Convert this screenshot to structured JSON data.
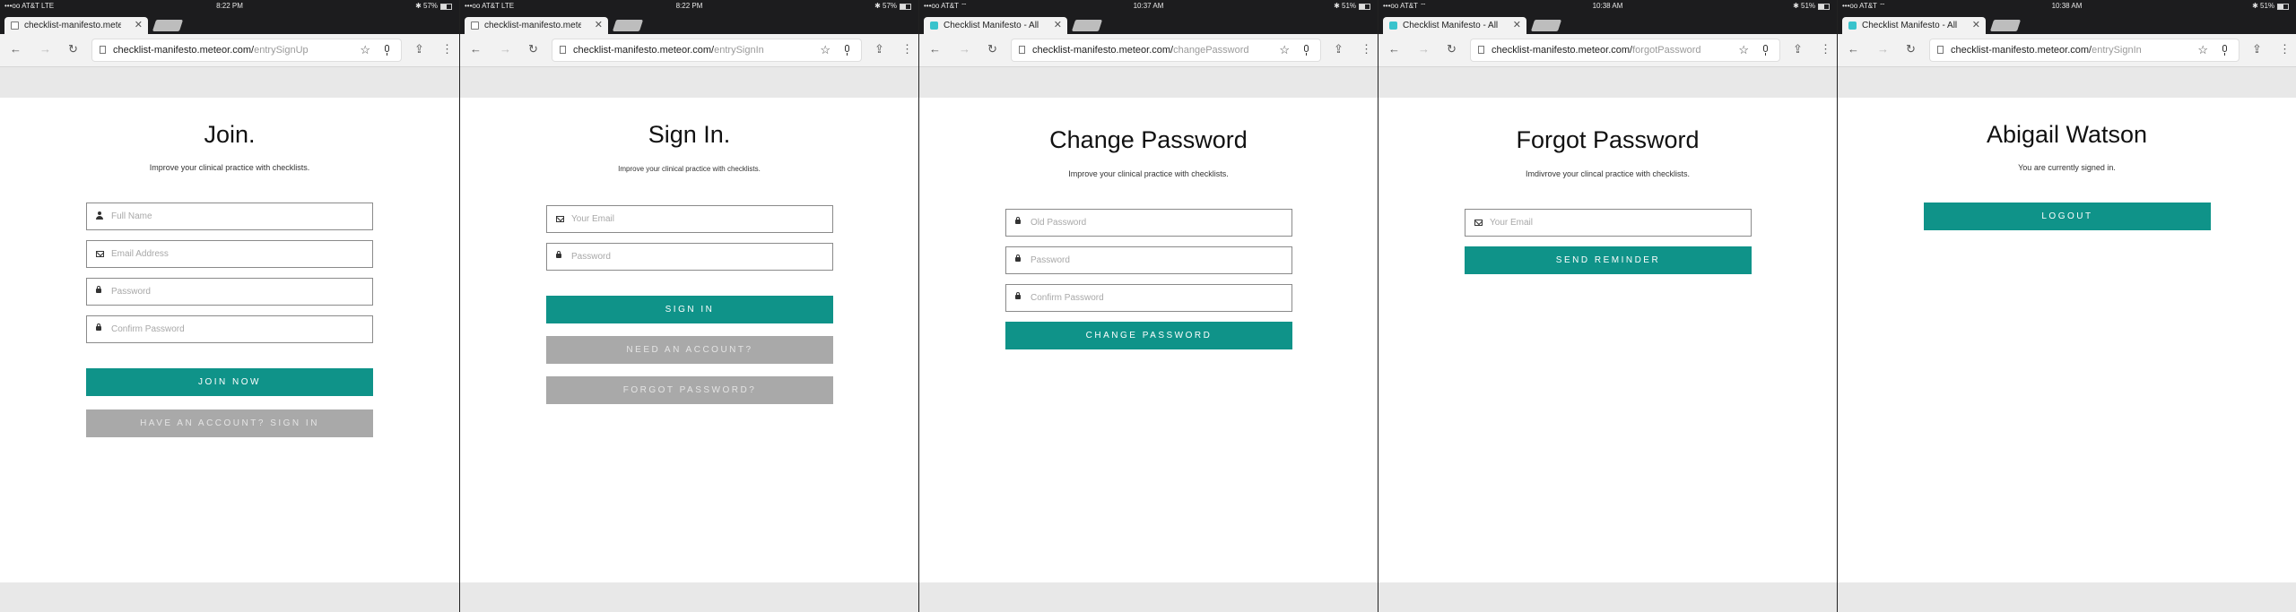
{
  "colors": {
    "accent": "#0f9389",
    "secondary": "#a9a9a9",
    "chrome_dark": "#1c1c1e",
    "chrome_light": "#f2f2f2"
  },
  "panels": [
    {
      "status": {
        "left": "•••oo AT&T  LTE",
        "time": "8:22 PM",
        "right": "✱ 57%",
        "battery": 0.57
      },
      "tab": {
        "title": "checklist-manifesto.meteor",
        "favicon": "page-icon"
      },
      "url": {
        "domain": "checklist-manifesto.meteor.com/",
        "path": "entrySignUp"
      },
      "title": "Join.",
      "subtitle": "Improve your clinical practice with checklists.",
      "fields": [
        {
          "placeholder": "Full Name",
          "icon": "person-icon"
        },
        {
          "placeholder": "Email Address",
          "icon": "envelope-icon"
        },
        {
          "placeholder": "Password",
          "icon": "lock-icon"
        },
        {
          "placeholder": "Confirm Password",
          "icon": "lock-icon"
        }
      ],
      "buttons": [
        {
          "label": "JOIN NOW"
        },
        {
          "label": "HAVE AN ACCOUNT? SIGN IN"
        }
      ]
    },
    {
      "status": {
        "left": "•••oo AT&T  LTE",
        "time": "8:22 PM",
        "right": "✱ 57%",
        "battery": 0.57
      },
      "tab": {
        "title": "checklist-manifesto.meteor",
        "favicon": "page-icon"
      },
      "url": {
        "domain": "checklist-manifesto.meteor.com/",
        "path": "entrySignIn"
      },
      "title": "Sign In.",
      "subtitle": "Improve your clinical practice with checklists.",
      "fields": [
        {
          "placeholder": "Your Email",
          "icon": "envelope-icon"
        },
        {
          "placeholder": "Password",
          "icon": "lock-icon"
        }
      ],
      "buttons": [
        {
          "label": "SIGN IN"
        },
        {
          "label": "NEED AN ACCOUNT?"
        },
        {
          "label": "FORGOT PASSWORD?"
        }
      ]
    },
    {
      "status": {
        "left": "•••oo AT&T  ⌔",
        "time": "10:37 AM",
        "right": "✱ 51%",
        "battery": 0.51
      },
      "tab": {
        "title": "Checklist Manifesto - All you",
        "favicon": "app-icon"
      },
      "url": {
        "domain": "checklist-manifesto.meteor.com/",
        "path": "changePassword"
      },
      "title": "Change Password",
      "subtitle": "Improve your clinical practice with checklists.",
      "fields": [
        {
          "placeholder": "Old Password",
          "icon": "lock-icon"
        },
        {
          "placeholder": "Password",
          "icon": "lock-icon"
        },
        {
          "placeholder": "Confirm Password",
          "icon": "lock-icon"
        }
      ],
      "buttons": [
        {
          "label": "CHANGE PASSWORD"
        }
      ]
    },
    {
      "status": {
        "left": "•••oo AT&T  ⌔",
        "time": "10:38 AM",
        "right": "✱ 51%",
        "battery": 0.51
      },
      "tab": {
        "title": "Checklist Manifesto - All you",
        "favicon": "app-icon"
      },
      "url": {
        "domain": "checklist-manifesto.meteor.com/",
        "path": "forgotPassword"
      },
      "title": "Forgot Password",
      "subtitle": "Imdivrove your clincal practice with checklists.",
      "fields": [
        {
          "placeholder": "Your Email",
          "icon": "envelope-icon"
        }
      ],
      "buttons": [
        {
          "label": "SEND REMINDER"
        }
      ]
    },
    {
      "status": {
        "left": "•••oo AT&T  ⌔",
        "time": "10:38 AM",
        "right": "✱ 51%",
        "battery": 0.51
      },
      "tab": {
        "title": "Checklist Manifesto - All you",
        "favicon": "app-icon"
      },
      "url": {
        "domain": "checklist-manifesto.meteor.com/",
        "path": "entrySignIn"
      },
      "title": "Abigail Watson",
      "subtitle": "You are currently signed in.",
      "fields": [],
      "buttons": [
        {
          "label": "LOGOUT"
        }
      ]
    }
  ]
}
